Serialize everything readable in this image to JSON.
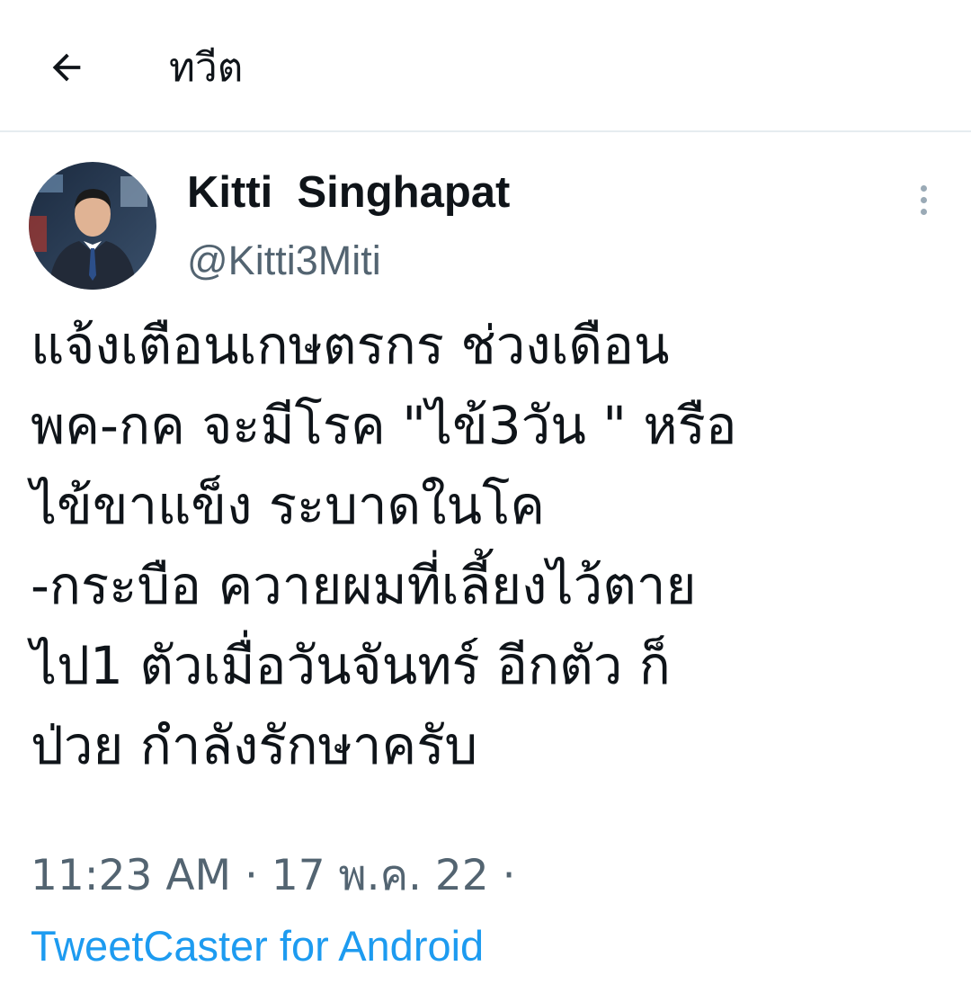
{
  "header": {
    "back_icon": "arrow-left-icon",
    "title": "ทวีต"
  },
  "tweet": {
    "author": {
      "display_name": "Kitti  Singhapat",
      "handle": "@Kitti3Miti",
      "avatar_icon": "user-avatar"
    },
    "more_icon": "more-vertical-icon",
    "text_lines": [
      "แจ้งเตือนเกษตรกร ช่วงเดือน",
      "พค-กค จะมีโรค \"ไข้3วัน \" หรือ",
      "ไข้ขาแข็ง ระบาดในโค",
      "-กระบือ ควายผมที่เลี้ยงไว้ตาย",
      "ไป1 ตัวเมื่อวันจันทร์ อีกตัว ก็",
      "ป่วย กำลังรักษาครับ"
    ],
    "meta": "11:23 AM · 17 พ.ค. 22 ·",
    "source": "TweetCaster for Android"
  },
  "colors": {
    "text": "#0f1419",
    "secondary": "#536471",
    "link": "#1d9bf0",
    "divider": "#e6ecf0"
  }
}
